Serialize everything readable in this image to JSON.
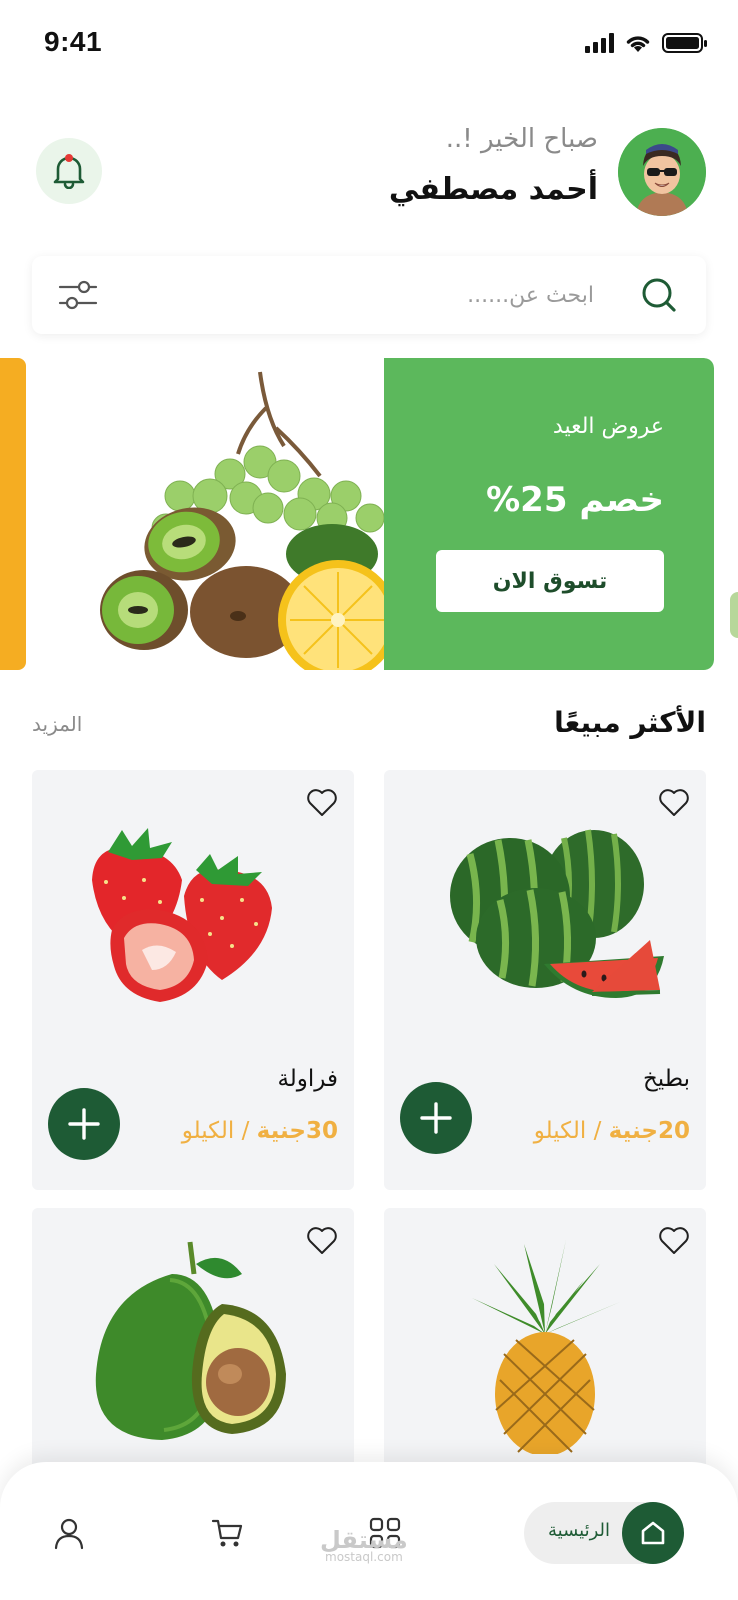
{
  "status_bar": {
    "time": "9:41"
  },
  "header": {
    "greeting": "صباح الخير !..",
    "user_name": "أحمد مصطفي"
  },
  "search": {
    "placeholder": "ابحث عن......"
  },
  "banner": {
    "label": "عروض العيد",
    "discount": "خصم 25%",
    "cta": "تسوق الان"
  },
  "section": {
    "title": "الأكثر مبيعًا",
    "more": "المزيد"
  },
  "products": [
    {
      "name": "بطيخ",
      "price": "20جنية",
      "unit": " / الكيلو"
    },
    {
      "name": "فراولة",
      "price": "30جنية",
      "unit": " / الكيلو"
    },
    {
      "name": "",
      "price": "",
      "unit": ""
    },
    {
      "name": "",
      "price": "",
      "unit": ""
    }
  ],
  "bottom_nav": {
    "home_label": "الرئيسية",
    "icons": [
      "home-icon",
      "categories-icon",
      "cart-icon",
      "profile-icon"
    ]
  },
  "watermark": {
    "arabic": "مستقل",
    "latin": "mostaql.com"
  },
  "colors": {
    "primary_green": "#1e5b35",
    "banner_green": "#5cb85c",
    "price_orange": "#f0b042",
    "banner_accent": "#f5ad22"
  }
}
